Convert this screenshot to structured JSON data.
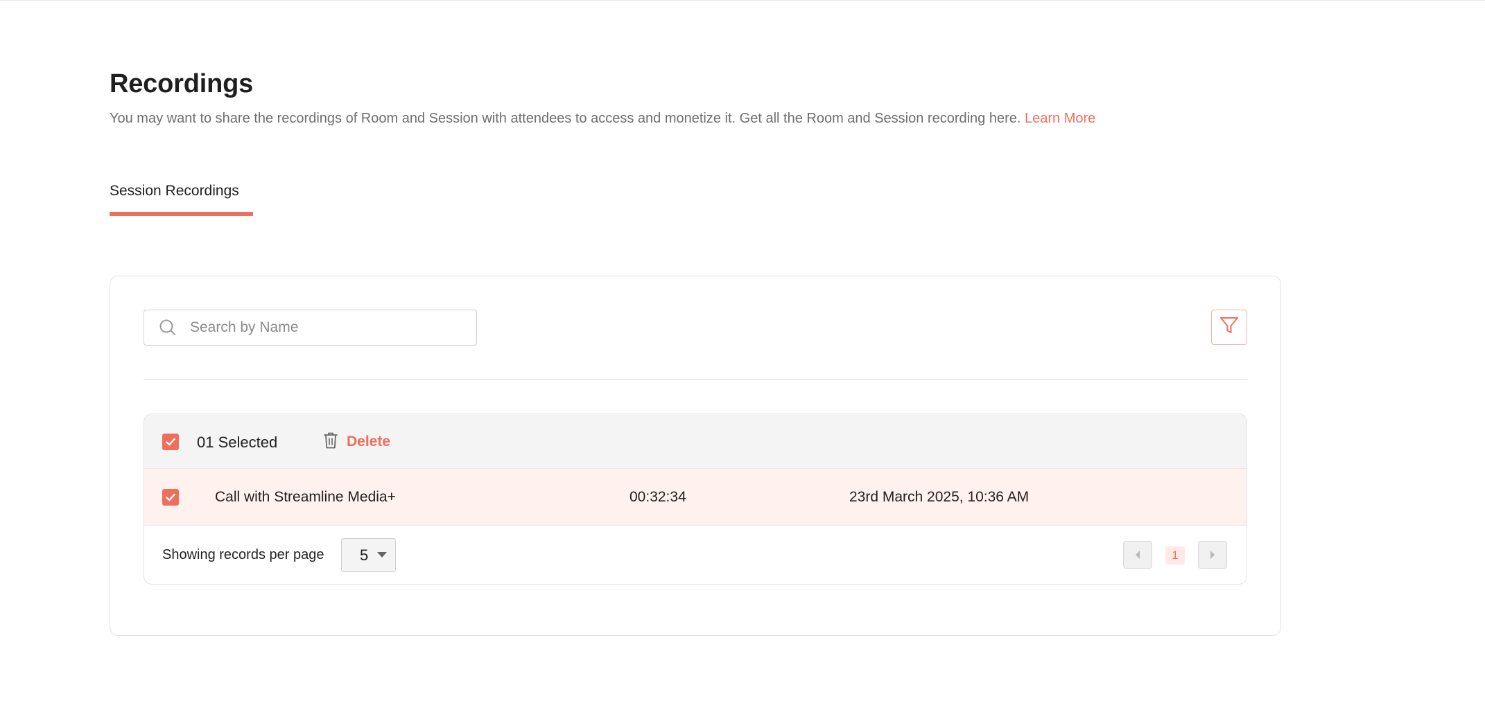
{
  "header": {
    "title": "Recordings",
    "description": "You may want to share the recordings of Room and Session with attendees to access and monetize it. Get all the Room and Session recording here.",
    "learn_more": "Learn More"
  },
  "tabs": [
    {
      "label": "Session Recordings",
      "active": true
    }
  ],
  "search": {
    "placeholder": "Search by Name",
    "value": ""
  },
  "selection": {
    "count_label": "01 Selected",
    "delete_label": "Delete"
  },
  "rows": [
    {
      "name": "Call with Streamline Media+",
      "duration": "00:32:34",
      "date": "23rd March 2025, 10:36 AM",
      "checked": true
    }
  ],
  "pagination": {
    "per_page_label": "Showing records per page",
    "per_page_value": "5",
    "current_page": "1"
  },
  "colors": {
    "accent": "#ee6f5c",
    "row_selected_bg": "#fff1ee",
    "header_bg": "#f4f4f4"
  },
  "icons": [
    "search-icon",
    "filter-icon",
    "trash-icon",
    "check-icon",
    "chevron-down-icon",
    "prev-page-icon",
    "next-page-icon"
  ]
}
